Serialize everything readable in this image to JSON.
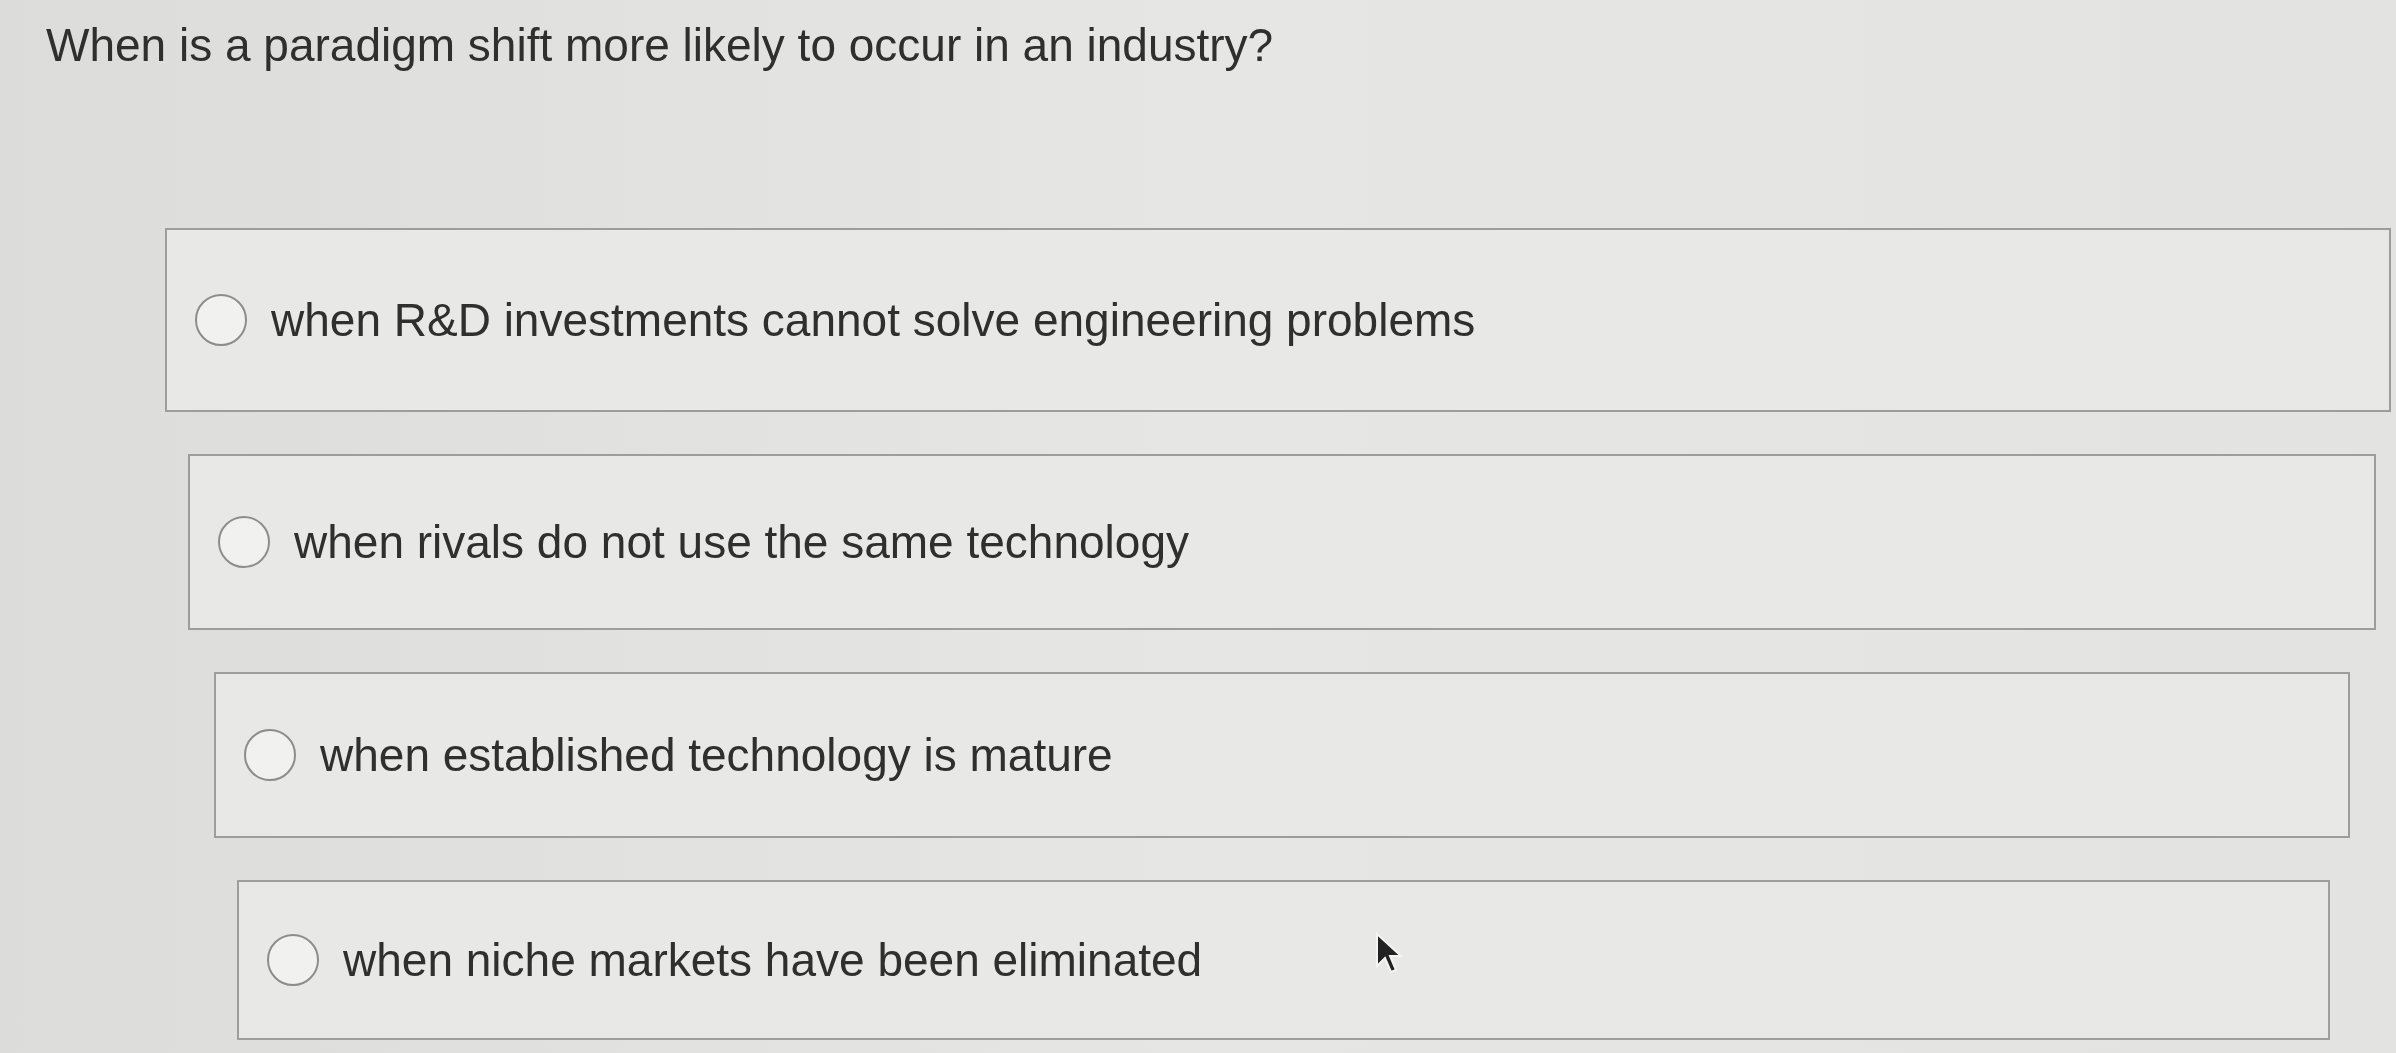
{
  "question": {
    "text": "When is a paradigm shift more likely to occur in an industry?"
  },
  "options": [
    {
      "label": "when R&D investments cannot solve engineering problems",
      "selected": false
    },
    {
      "label": "when rivals do not use the same technology",
      "selected": false
    },
    {
      "label": "when established technology is mature",
      "selected": false
    },
    {
      "label": "when niche markets have been eliminated",
      "selected": false
    }
  ]
}
